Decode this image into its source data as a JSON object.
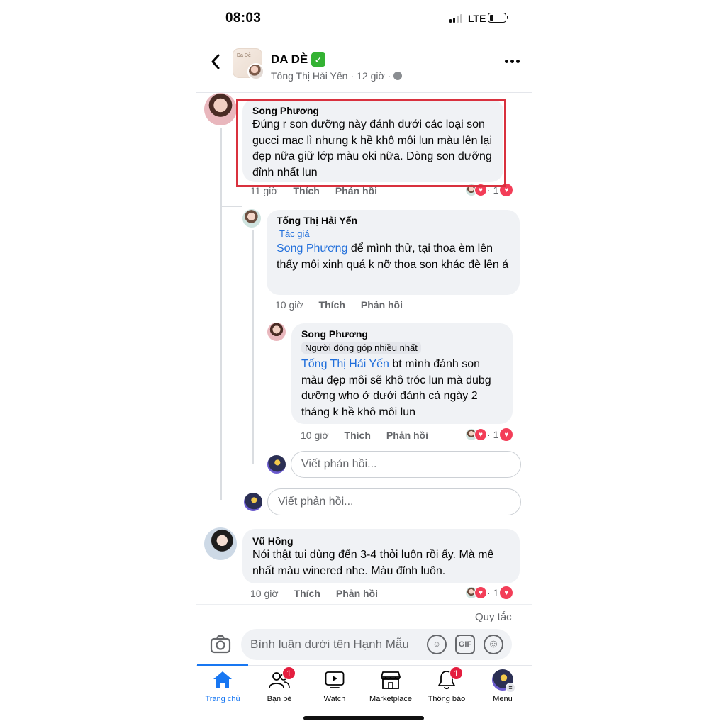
{
  "status": {
    "time": "08:03",
    "network": "LTE"
  },
  "header": {
    "page_name": "DA DÈ",
    "verified_emoji": "✅",
    "author": "Tống Thị Hải Yến",
    "separator": "·",
    "time": "12 giờ",
    "avatar_text": "Da Dè"
  },
  "comments": [
    {
      "name": "Song Phương",
      "text": "Đúng r son dưỡng này đánh dưới các loại son gucci mac lì nhưng k hề khô môi lun màu lên lại đẹp nữa giữ lớp màu oki nữa. Dòng son dưỡng đỉnh nhất lun",
      "time": "11 giờ",
      "like": "Thích",
      "reply": "Phản hồi",
      "reaction_count": "1"
    },
    {
      "name": "Tống Thị Hải Yến",
      "badge": "Tác giả",
      "mention": "Song Phương",
      "text": " để mình thử, tại thoa èm lên thấy môi xinh quá k nỡ thoa son khác đè lên á",
      "time": "10 giờ",
      "like": "Thích",
      "reply": "Phản hồi"
    },
    {
      "name": "Song Phương",
      "badge": "Người đóng góp nhiều nhất",
      "mention": "Tống Thị Hải Yến",
      "text": " bt mình đánh son màu đẹp môi sẽ khô tróc lun mà dubg dưỡng who ở dưới đánh cả ngày 2 tháng k hề khô môi lun",
      "time": "10 giờ",
      "like": "Thích",
      "reply": "Phản hồi",
      "reaction_count": "1"
    },
    {
      "name": "Vũ Hồng",
      "text": "Nói thật tui dùng đến 3-4 thỏi luôn rồi ấy. Mà mê nhất màu winered nhe. Màu đỉnh luôn.",
      "time": "10 giờ",
      "like": "Thích",
      "reply": "Phản hồi",
      "reaction_count": "1"
    }
  ],
  "reply_placeholder": "Viết phản hồi...",
  "rules_link": "Quy tắc",
  "composer": {
    "placeholder": "Bình luận dưới tên Hạnh Mẫu",
    "gif_label": "GIF"
  },
  "tabs": [
    {
      "label": "Trang chủ",
      "icon": "home-icon"
    },
    {
      "label": "Bạn bè",
      "icon": "friends-icon",
      "badge": "1"
    },
    {
      "label": "Watch",
      "icon": "watch-icon"
    },
    {
      "label": "Marketplace",
      "icon": "marketplace-icon"
    },
    {
      "label": "Thông báo",
      "icon": "bell-icon",
      "badge": "1"
    },
    {
      "label": "Menu",
      "icon": "menu-avatar-icon"
    }
  ],
  "colors": {
    "accent": "#1877f2",
    "mention": "#216fdb",
    "highlight_box": "#d9313e",
    "badge": "#e41e3f",
    "heart": "#f33e58"
  }
}
